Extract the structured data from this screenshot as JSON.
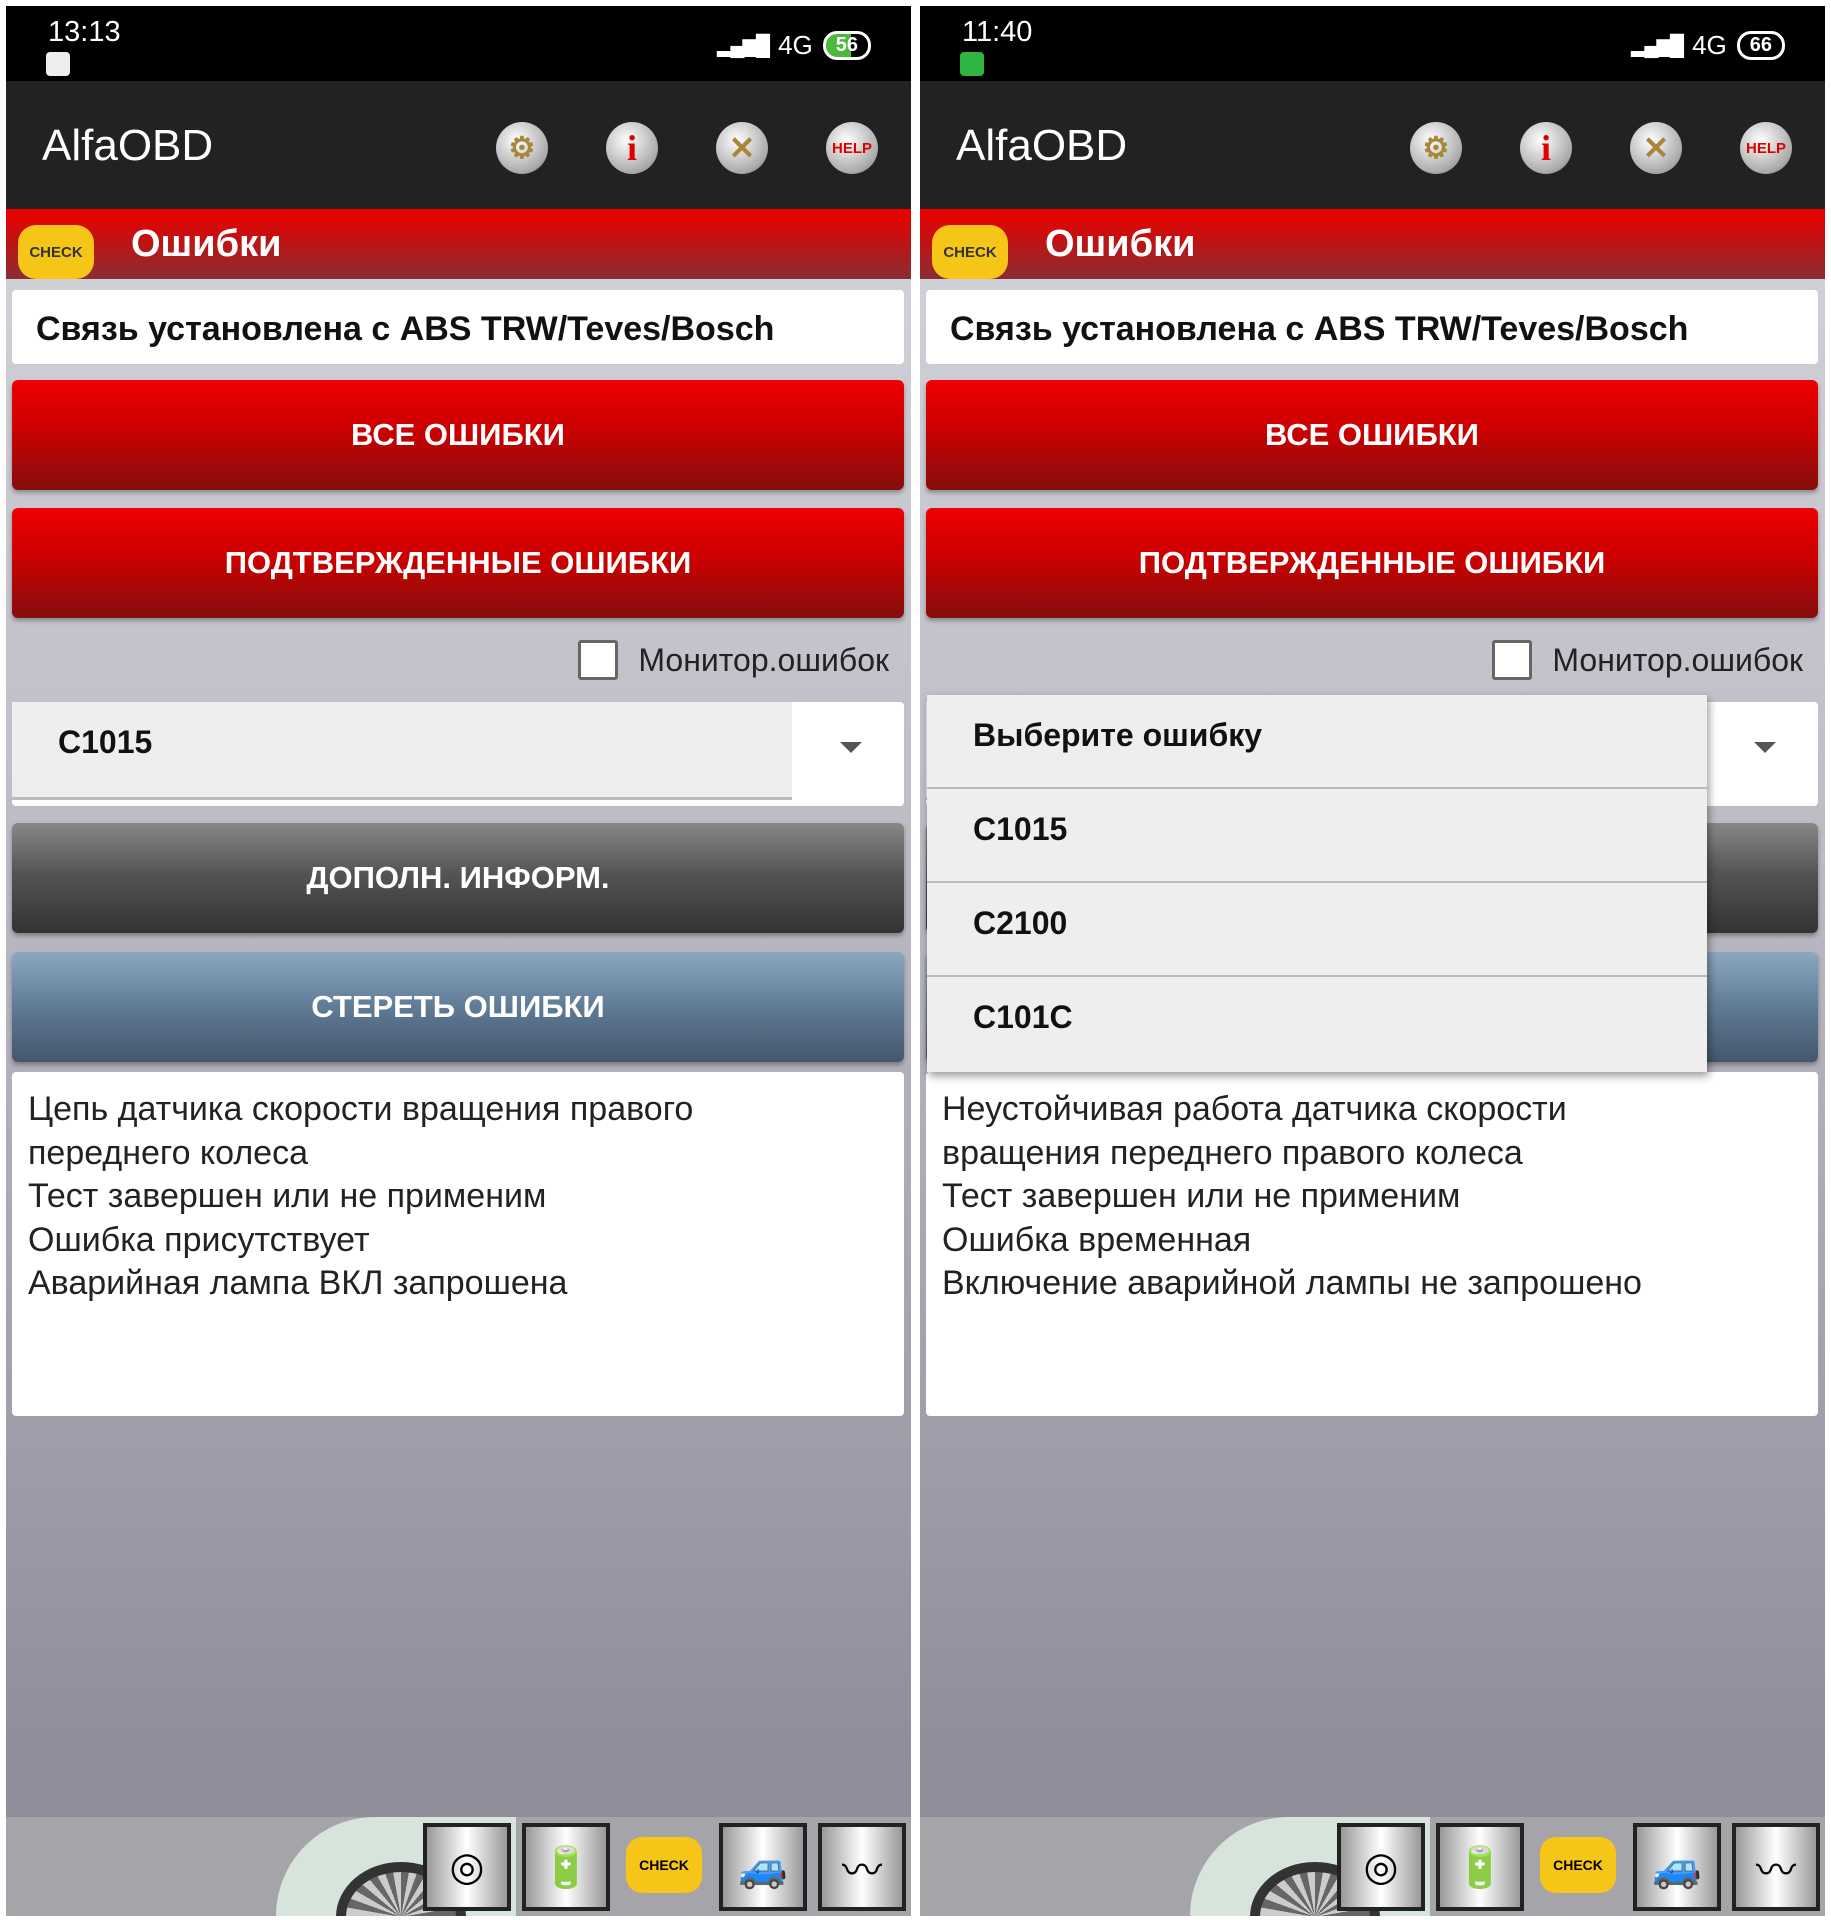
{
  "panels": [
    {
      "status": {
        "time": "13:13",
        "network": "4G",
        "battery": "56"
      },
      "app_title": "AlfaOBD",
      "section_title": "Ошибки",
      "check_label": "CHECK",
      "connection": "Связь установлена с ABS TRW/Teves/Bosch",
      "btn_all": "ВСЕ ОШИБКИ",
      "btn_confirmed": "ПОДТВЕРЖДЕННЫЕ ОШИБКИ",
      "monitor_label": "Монитор.ошибок",
      "selected_error": "C1015",
      "btn_info": "ДОПОЛН. ИНФОРМ.",
      "btn_clear": "СТЕРЕТЬ ОШИБКИ",
      "description": [
        "Цепь датчика скорости вращения правого",
        "переднего колеса",
        "Тест завершен или не применим",
        "Ошибка присутствует",
        "Аварийная лампа ВКЛ запрошена"
      ]
    },
    {
      "status": {
        "time": "11:40",
        "network": "4G",
        "battery": "66"
      },
      "app_title": "AlfaOBD",
      "section_title": "Ошибки",
      "check_label": "CHECK",
      "connection": "Связь установлена с ABS TRW/Teves/Bosch",
      "btn_all": "ВСЕ ОШИБКИ",
      "btn_confirmed": "ПОДТВЕРЖДЕННЫЕ ОШИБКИ",
      "monitor_label": "Монитор.ошибок",
      "dropdown_options": [
        "Выберите ошибку",
        "C1015",
        "C2100",
        "C101C"
      ],
      "description": [
        "Неустойчивая работа датчика скорости",
        "вращения переднего правого колеса",
        "Тест завершен или не применим",
        "Ошибка временная",
        "Включение аварийной лампы не запрошено"
      ]
    }
  ],
  "toolbar_icons": [
    "help-icon-label:HELP"
  ],
  "help_label": "HELP",
  "colors": {
    "accent_red": "#cc0000",
    "appbar": "#222222",
    "check_yellow": "#f5c518"
  }
}
